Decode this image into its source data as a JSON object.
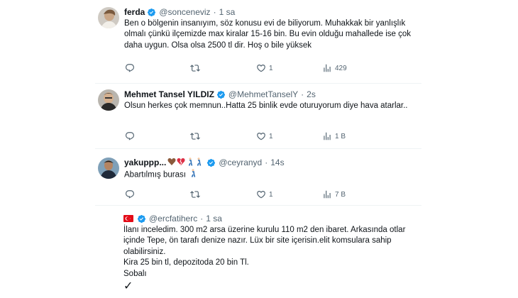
{
  "tweets": [
    {
      "name": "ferda",
      "handle": "@sonceneviz",
      "dot": "·",
      "time": "1 sa",
      "text": "Ben o bölgenin insanıyım, söz konusu evi de biliyorum. Muhakkak bir yanlışlık olmalı çünkü ilçemizde max kiralar 15-16 bin. Bu evin olduğu mahallede ise çok daha uygun. Olsa olsa 2500 tl dir. Hoş o bile yüksek",
      "like_count": "1",
      "view_count": "429"
    },
    {
      "name": "Mehmet Tansel YILDIZ",
      "handle": "@MehmetTanselY",
      "dot": "·",
      "time": "2s",
      "text": "Olsun herkes çok memnun..Hatta 25 binlik evde oturuyorum diye hava atarlar..",
      "like_count": "1",
      "view_count": "1 B"
    },
    {
      "name": "yakuppp...",
      "name_emoji": "🤎💔🚶🚶",
      "handle": "@ceyranyd",
      "dot": "·",
      "time": "14s",
      "text": "Abartılmış burası",
      "text_emoji": "🚶",
      "like_count": "1",
      "view_count": "7 B"
    },
    {
      "handle": "@ercfatiherc",
      "dot": "·",
      "time": "1 sa",
      "text_lines": [
        "İlanı inceledim. 300 m2 arsa üzerine kurulu 110 m2 den ibaret. Arkasında otlar içinde Tepe, ön tarafı denize nazır. Lüx bir site içerisin.elit komsulara sahip olabilirsiniz.",
        "Kira 25 bin tl, depozitoda 20 bin Tl.",
        "Sobalı"
      ],
      "check_glyph": "✓"
    }
  ],
  "colors": {
    "text": "#0f1419",
    "muted": "#536471",
    "verified": "#1d9bf0",
    "divider": "#eff3f4",
    "flag": "#e30a17"
  },
  "icons": [
    "reply-icon",
    "retweet-icon",
    "like-icon",
    "views-icon",
    "verified-icon",
    "turkey-flag-icon"
  ]
}
